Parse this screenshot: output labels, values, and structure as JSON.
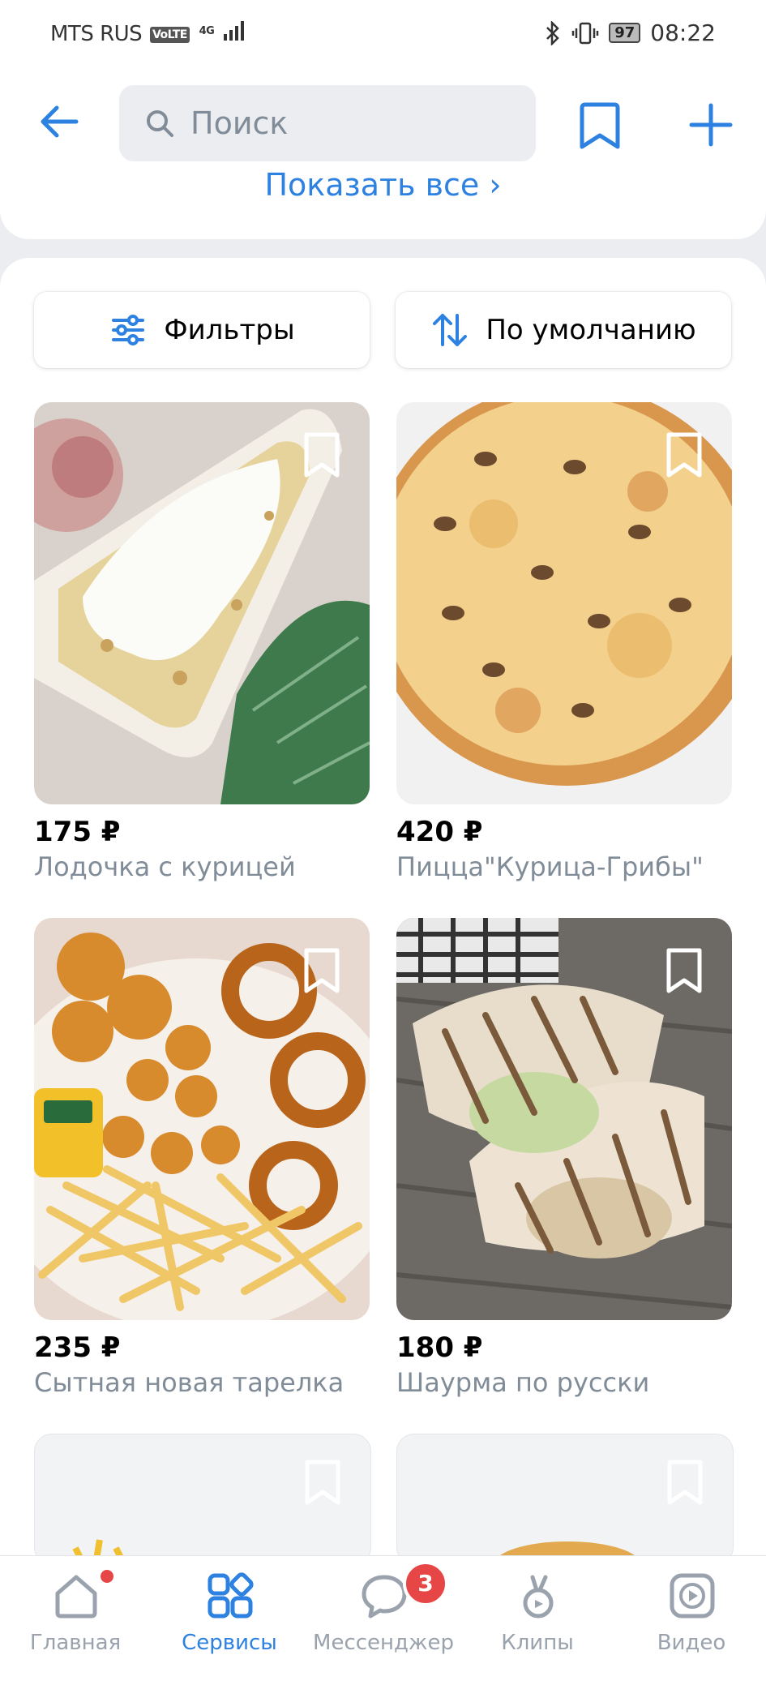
{
  "status_bar": {
    "carrier": "MTS RUS",
    "volte": "VoLTE",
    "network": "4G",
    "battery": "97",
    "time": "08:22"
  },
  "header": {
    "search_placeholder": "Поиск",
    "show_all": "Показать все ›"
  },
  "toolbar": {
    "filters_label": "Фильтры",
    "sort_label": "По умолчанию"
  },
  "products": [
    {
      "price": "175 ₽",
      "title": "Лодочка с курицей",
      "image": "chicken-cheese-boat"
    },
    {
      "price": "420 ₽",
      "title": "Пицца\"Курица-Грибы\"",
      "image": "chicken-mushroom-pizza"
    },
    {
      "price": "235 ₽",
      "title": "Сытная новая тарелка",
      "image": "nuggets-fries-rings-plate"
    },
    {
      "price": "180 ₽",
      "title": "Шаурма по русски",
      "image": "shawarma"
    }
  ],
  "tabbar": {
    "items": [
      {
        "label": "Главная",
        "icon": "home-icon"
      },
      {
        "label": "Сервисы",
        "icon": "services-icon",
        "active": true
      },
      {
        "label": "Мессенджер",
        "icon": "messenger-icon",
        "badge": "3"
      },
      {
        "label": "Клипы",
        "icon": "clips-icon"
      },
      {
        "label": "Видео",
        "icon": "video-icon"
      }
    ]
  },
  "colors": {
    "accent": "#2d81e0",
    "badge": "#e64646",
    "secondary_text": "#818c99"
  }
}
